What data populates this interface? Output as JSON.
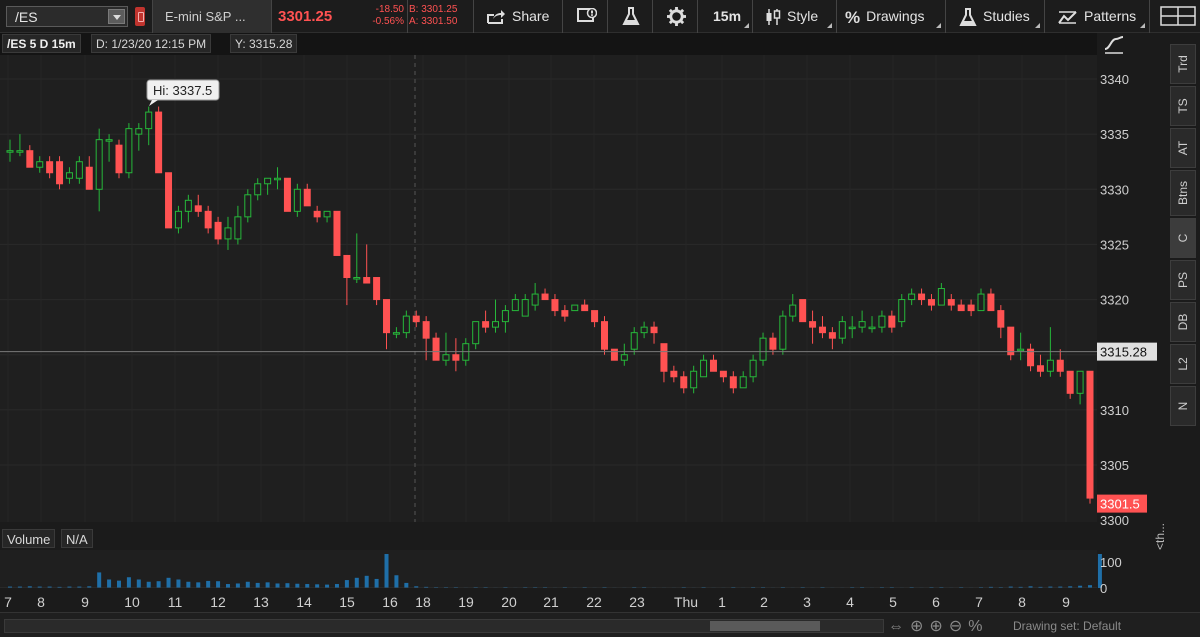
{
  "toolbar": {
    "symbol": "/ES",
    "description": "E-mini S&P ...",
    "last_price": "3301.25",
    "net_change": "-18.50",
    "pct_change": "-0.56%",
    "bid": "B: 3301.25",
    "ask": "A: 3301.50",
    "share_label": "Share",
    "timeframe_label": "15m",
    "style_label": "Style",
    "drawings_label": "Drawings",
    "studies_label": "Studies",
    "patterns_label": "Patterns",
    "colors": {
      "down": "#ff5252",
      "up": "#26b83a"
    }
  },
  "info": {
    "title": "/ES 5 D 15m",
    "date": "D: 1/23/20 12:15 PM",
    "y": "Y: 3315.28"
  },
  "side_tabs": [
    "Trd",
    "TS",
    "AT",
    "Btns",
    "C",
    "PS",
    "DB",
    "L2",
    "N"
  ],
  "volume": {
    "label": "Volume",
    "value": "N/A",
    "axis_top": "100",
    "axis_zero": "0"
  },
  "bottom": {
    "drawing_set": "Drawing set: Default",
    "th_label": "<th..."
  },
  "chart_data": {
    "type": "candlestick",
    "y_ticks": [
      3340,
      3335,
      3330,
      3325,
      3320,
      3315,
      3310,
      3305,
      3300
    ],
    "ylim": [
      3299.5,
      3343
    ],
    "x_labels": [
      "7",
      "8",
      "9",
      "10",
      "11",
      "12",
      "13",
      "14",
      "15",
      "16",
      "18",
      "19",
      "20",
      "21",
      "22",
      "23",
      "Thu",
      "1",
      "2",
      "3",
      "4",
      "5",
      "6",
      "7",
      "8",
      "9"
    ],
    "hi_label": "Hi: 3337.5",
    "cursor_price": "3315.28",
    "last_price_label": "3301.5",
    "bars": [
      {
        "o": 3333.5,
        "h": 3334.5,
        "l": 3332.5,
        "c": 3333.5
      },
      {
        "o": 3333.5,
        "h": 3335,
        "l": 3333,
        "c": 3333.5
      },
      {
        "o": 3333.5,
        "h": 3334,
        "l": 3332,
        "c": 3332
      },
      {
        "o": 3332,
        "h": 3333,
        "l": 3331.5,
        "c": 3332.5
      },
      {
        "o": 3332.5,
        "h": 3333,
        "l": 3331,
        "c": 3331.5
      },
      {
        "o": 3332.5,
        "h": 3333,
        "l": 3330,
        "c": 3330.5
      },
      {
        "o": 3331,
        "h": 3332,
        "l": 3330.5,
        "c": 3331.5
      },
      {
        "o": 3331,
        "h": 3333,
        "l": 3330.5,
        "c": 3332.5
      },
      {
        "o": 3332,
        "h": 3333,
        "l": 3330,
        "c": 3330
      },
      {
        "o": 3330,
        "h": 3335.5,
        "l": 3328,
        "c": 3334.5
      },
      {
        "o": 3334.5,
        "h": 3335,
        "l": 3332.5,
        "c": 3334.5
      },
      {
        "o": 3334,
        "h": 3334.5,
        "l": 3331,
        "c": 3331.5
      },
      {
        "o": 3331.5,
        "h": 3336,
        "l": 3331,
        "c": 3335.5
      },
      {
        "o": 3335,
        "h": 3336,
        "l": 3333.5,
        "c": 3335.5
      },
      {
        "o": 3335.5,
        "h": 3337.5,
        "l": 3334,
        "c": 3337
      },
      {
        "o": 3337,
        "h": 3337.5,
        "l": 3331.5,
        "c": 3331.5
      },
      {
        "o": 3331.5,
        "h": 3331.5,
        "l": 3326.5,
        "c": 3326.5
      },
      {
        "o": 3326.5,
        "h": 3328.5,
        "l": 3326,
        "c": 3328
      },
      {
        "o": 3328,
        "h": 3329.5,
        "l": 3327,
        "c": 3329
      },
      {
        "o": 3328.5,
        "h": 3329.5,
        "l": 3327.5,
        "c": 3328
      },
      {
        "o": 3328,
        "h": 3328.5,
        "l": 3326,
        "c": 3326.5
      },
      {
        "o": 3327,
        "h": 3327.5,
        "l": 3325,
        "c": 3325.5
      },
      {
        "o": 3325.5,
        "h": 3327.5,
        "l": 3324.5,
        "c": 3326.5
      },
      {
        "o": 3325.5,
        "h": 3328.5,
        "l": 3325,
        "c": 3327.5
      },
      {
        "o": 3327.5,
        "h": 3330,
        "l": 3327,
        "c": 3329.5
      },
      {
        "o": 3329.5,
        "h": 3331,
        "l": 3329,
        "c": 3330.5
      },
      {
        "o": 3330.5,
        "h": 3331,
        "l": 3329.5,
        "c": 3331
      },
      {
        "o": 3331,
        "h": 3332,
        "l": 3330,
        "c": 3331
      },
      {
        "o": 3331,
        "h": 3331,
        "l": 3328,
        "c": 3328
      },
      {
        "o": 3328,
        "h": 3330.5,
        "l": 3327.5,
        "c": 3330
      },
      {
        "o": 3330,
        "h": 3330.5,
        "l": 3328.5,
        "c": 3328.5
      },
      {
        "o": 3328,
        "h": 3328.5,
        "l": 3327,
        "c": 3327.5
      },
      {
        "o": 3327.5,
        "h": 3328,
        "l": 3327,
        "c": 3328
      },
      {
        "o": 3328,
        "h": 3328,
        "l": 3324,
        "c": 3324
      },
      {
        "o": 3324,
        "h": 3324,
        "l": 3319.5,
        "c": 3322
      },
      {
        "o": 3322,
        "h": 3326,
        "l": 3321.5,
        "c": 3322
      },
      {
        "o": 3322,
        "h": 3325,
        "l": 3321.5,
        "c": 3321.5
      },
      {
        "o": 3322,
        "h": 3322,
        "l": 3319.5,
        "c": 3320
      },
      {
        "o": 3320,
        "h": 3320,
        "l": 3315.5,
        "c": 3317
      },
      {
        "o": 3317,
        "h": 3317.5,
        "l": 3316.5,
        "c": 3317
      },
      {
        "o": 3317,
        "h": 3319,
        "l": 3316.5,
        "c": 3318.5
      },
      {
        "o": 3318.5,
        "h": 3319,
        "l": 3317.5,
        "c": 3318
      },
      {
        "o": 3318,
        "h": 3318.5,
        "l": 3314.5,
        "c": 3316.5
      },
      {
        "o": 3316.5,
        "h": 3317,
        "l": 3314.5,
        "c": 3314.5
      },
      {
        "o": 3314.5,
        "h": 3317,
        "l": 3314,
        "c": 3315
      },
      {
        "o": 3315,
        "h": 3316.5,
        "l": 3313.5,
        "c": 3314.5
      },
      {
        "o": 3314.5,
        "h": 3316.5,
        "l": 3314,
        "c": 3316
      },
      {
        "o": 3316,
        "h": 3318,
        "l": 3315.5,
        "c": 3318
      },
      {
        "o": 3318,
        "h": 3319,
        "l": 3317,
        "c": 3317.5
      },
      {
        "o": 3317.5,
        "h": 3320,
        "l": 3317,
        "c": 3318
      },
      {
        "o": 3318,
        "h": 3319.5,
        "l": 3317,
        "c": 3319
      },
      {
        "o": 3319,
        "h": 3320.5,
        "l": 3319,
        "c": 3320
      },
      {
        "o": 3318.5,
        "h": 3320.5,
        "l": 3318.5,
        "c": 3320
      },
      {
        "o": 3319.5,
        "h": 3321.5,
        "l": 3319,
        "c": 3320.5
      },
      {
        "o": 3320.5,
        "h": 3321,
        "l": 3320,
        "c": 3320
      },
      {
        "o": 3320,
        "h": 3320.5,
        "l": 3318.5,
        "c": 3319
      },
      {
        "o": 3319,
        "h": 3319.5,
        "l": 3318,
        "c": 3318.5
      },
      {
        "o": 3319,
        "h": 3319.5,
        "l": 3319,
        "c": 3319.5
      },
      {
        "o": 3319.5,
        "h": 3320,
        "l": 3319,
        "c": 3319
      },
      {
        "o": 3319,
        "h": 3319,
        "l": 3317.5,
        "c": 3318
      },
      {
        "o": 3318,
        "h": 3318.5,
        "l": 3315,
        "c": 3315.5
      },
      {
        "o": 3315.5,
        "h": 3315.5,
        "l": 3314.5,
        "c": 3314.5
      },
      {
        "o": 3314.5,
        "h": 3316,
        "l": 3314,
        "c": 3315
      },
      {
        "o": 3315.5,
        "h": 3317.5,
        "l": 3315,
        "c": 3317
      },
      {
        "o": 3317,
        "h": 3318,
        "l": 3316.5,
        "c": 3317.5
      },
      {
        "o": 3317.5,
        "h": 3318,
        "l": 3316,
        "c": 3317
      },
      {
        "o": 3316,
        "h": 3316,
        "l": 3312.5,
        "c": 3313.5
      },
      {
        "o": 3313.5,
        "h": 3314,
        "l": 3312.5,
        "c": 3313
      },
      {
        "o": 3313,
        "h": 3313.5,
        "l": 3311.5,
        "c": 3312
      },
      {
        "o": 3312,
        "h": 3314,
        "l": 3311.5,
        "c": 3313.5
      },
      {
        "o": 3313,
        "h": 3315,
        "l": 3313,
        "c": 3314.5
      },
      {
        "o": 3314.5,
        "h": 3315,
        "l": 3313.5,
        "c": 3313.5
      },
      {
        "o": 3313.5,
        "h": 3313.5,
        "l": 3312.5,
        "c": 3313
      },
      {
        "o": 3313,
        "h": 3313.5,
        "l": 3311.5,
        "c": 3312
      },
      {
        "o": 3312,
        "h": 3313.5,
        "l": 3312,
        "c": 3313
      },
      {
        "o": 3313,
        "h": 3315,
        "l": 3312.5,
        "c": 3314.5
      },
      {
        "o": 3314.5,
        "h": 3317,
        "l": 3314,
        "c": 3316.5
      },
      {
        "o": 3316.5,
        "h": 3317,
        "l": 3315,
        "c": 3315.5
      },
      {
        "o": 3315.5,
        "h": 3319,
        "l": 3315,
        "c": 3318.5
      },
      {
        "o": 3318.5,
        "h": 3320.5,
        "l": 3318,
        "c": 3319.5
      },
      {
        "o": 3320,
        "h": 3320,
        "l": 3318,
        "c": 3318
      },
      {
        "o": 3318,
        "h": 3319,
        "l": 3316,
        "c": 3317.5
      },
      {
        "o": 3317.5,
        "h": 3318.5,
        "l": 3316.5,
        "c": 3317
      },
      {
        "o": 3317,
        "h": 3317.5,
        "l": 3315.5,
        "c": 3316.5
      },
      {
        "o": 3316.5,
        "h": 3318.5,
        "l": 3316,
        "c": 3318
      },
      {
        "o": 3317.5,
        "h": 3318.5,
        "l": 3316.5,
        "c": 3317.5
      },
      {
        "o": 3317.5,
        "h": 3319,
        "l": 3317,
        "c": 3318
      },
      {
        "o": 3317.5,
        "h": 3318.5,
        "l": 3317,
        "c": 3317.5
      },
      {
        "o": 3317.5,
        "h": 3319,
        "l": 3317,
        "c": 3318.5
      },
      {
        "o": 3318.5,
        "h": 3319,
        "l": 3317,
        "c": 3317.5
      },
      {
        "o": 3318,
        "h": 3320.5,
        "l": 3317.5,
        "c": 3320
      },
      {
        "o": 3320,
        "h": 3321,
        "l": 3319.5,
        "c": 3320.5
      },
      {
        "o": 3320.5,
        "h": 3321,
        "l": 3319.5,
        "c": 3320
      },
      {
        "o": 3320,
        "h": 3320.5,
        "l": 3319,
        "c": 3319.5
      },
      {
        "o": 3319.5,
        "h": 3321.5,
        "l": 3319.5,
        "c": 3321
      },
      {
        "o": 3320,
        "h": 3320.5,
        "l": 3319,
        "c": 3319.5
      },
      {
        "o": 3319.5,
        "h": 3320,
        "l": 3319,
        "c": 3319
      },
      {
        "o": 3319.5,
        "h": 3320,
        "l": 3318.5,
        "c": 3319
      },
      {
        "o": 3319,
        "h": 3321,
        "l": 3319,
        "c": 3320.5
      },
      {
        "o": 3320.5,
        "h": 3321,
        "l": 3319,
        "c": 3319
      },
      {
        "o": 3319,
        "h": 3319.5,
        "l": 3316.5,
        "c": 3317.5
      },
      {
        "o": 3317.5,
        "h": 3317.5,
        "l": 3314.5,
        "c": 3315
      },
      {
        "o": 3315.5,
        "h": 3317,
        "l": 3314.5,
        "c": 3315.5
      },
      {
        "o": 3315.5,
        "h": 3316,
        "l": 3313.5,
        "c": 3314
      },
      {
        "o": 3314,
        "h": 3315,
        "l": 3313,
        "c": 3313.5
      },
      {
        "o": 3313.5,
        "h": 3317.5,
        "l": 3313,
        "c": 3314.5
      },
      {
        "o": 3314.5,
        "h": 3315.5,
        "l": 3313,
        "c": 3313.5
      },
      {
        "o": 3313.5,
        "h": 3313.5,
        "l": 3311,
        "c": 3311.5
      },
      {
        "o": 3311.5,
        "h": 3313.5,
        "l": 3310.5,
        "c": 3313.5
      },
      {
        "o": 3313.5,
        "h": 3313.5,
        "l": 3301.5,
        "c": 3302
      }
    ],
    "volume": [
      5,
      5,
      6,
      5,
      5,
      4,
      5,
      5,
      6,
      55,
      30,
      26,
      38,
      30,
      22,
      24,
      36,
      30,
      22,
      20,
      25,
      24,
      14,
      16,
      22,
      18,
      20,
      16,
      17,
      15,
      14,
      13,
      12,
      14,
      28,
      36,
      43,
      32,
      120,
      45,
      18,
      6,
      4,
      3,
      3,
      3,
      2,
      3,
      3,
      2,
      3,
      2,
      3,
      3,
      3,
      2,
      3,
      2,
      3,
      2,
      3,
      2,
      2,
      3,
      3,
      2,
      2,
      2,
      3,
      2,
      3,
      2,
      2,
      3,
      2,
      3,
      3,
      2,
      3,
      2,
      3,
      2,
      3,
      2,
      2,
      3,
      3,
      2,
      3,
      3,
      2,
      3,
      2,
      3,
      3,
      2,
      3,
      2,
      3,
      4,
      3,
      5,
      4,
      6,
      4,
      5,
      5,
      6,
      8,
      10,
      120
    ],
    "volume_ylim": [
      0,
      120
    ]
  }
}
